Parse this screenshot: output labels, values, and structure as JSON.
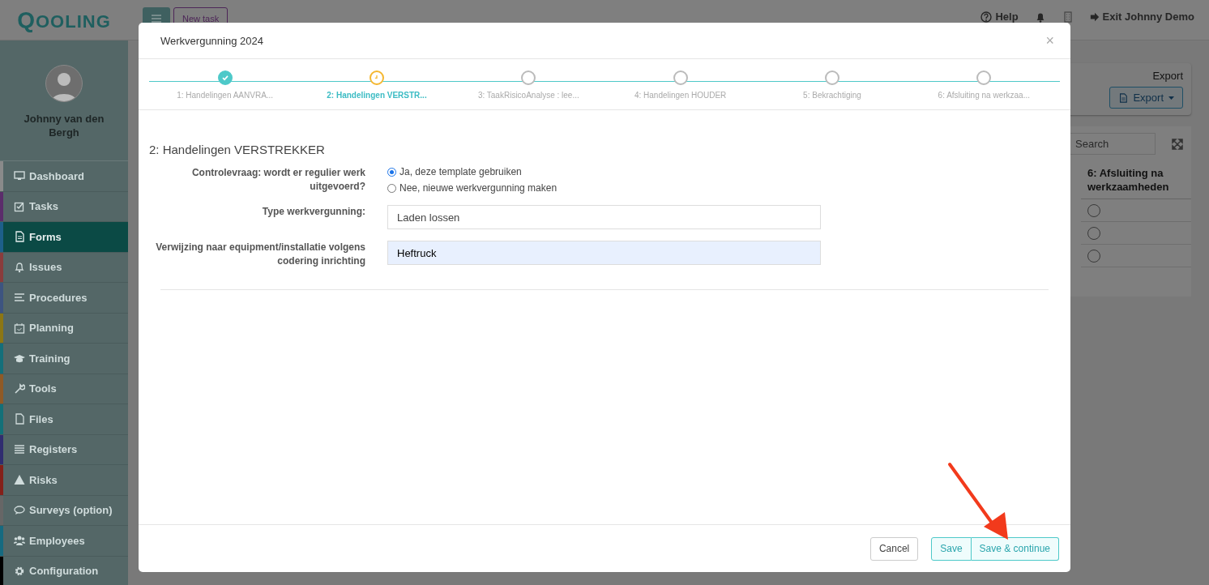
{
  "app": {
    "logo": "QOOLING"
  },
  "topbar": {
    "new_task": "New task",
    "help": "Help",
    "exit": "Exit Johnny Demo"
  },
  "user": {
    "name": "Johnny van den Bergh"
  },
  "sidebar": {
    "items": [
      {
        "label": "Dashboard",
        "selected": false,
        "color": "#8a8a8a"
      },
      {
        "label": "Tasks",
        "selected": false,
        "color": "#5b2d6b"
      },
      {
        "label": "Forms",
        "selected": true,
        "color": "#1d5f8a"
      },
      {
        "label": "Issues",
        "selected": false,
        "color": "#8a3c3c"
      },
      {
        "label": "Procedures",
        "selected": false,
        "color": "#3d5480"
      },
      {
        "label": "Planning",
        "selected": false,
        "color": "#8c7614"
      },
      {
        "label": "Training",
        "selected": false,
        "color": "#146f7a"
      },
      {
        "label": "Tools",
        "selected": false,
        "color": "#8f5a26"
      },
      {
        "label": "Files",
        "selected": false,
        "color": "#137078"
      },
      {
        "label": "Registers",
        "selected": false,
        "color": "#302d70"
      },
      {
        "label": "Risks",
        "selected": false,
        "color": "#842019"
      },
      {
        "label": "Surveys (option)",
        "selected": false,
        "color": "#666666"
      },
      {
        "label": "Employees",
        "selected": false,
        "color": "#166a80"
      },
      {
        "label": "Configuration",
        "selected": false,
        "color": "#000000"
      }
    ]
  },
  "export_panel": {
    "label": "Export",
    "button": "Export"
  },
  "table": {
    "search": {
      "placeholder": "Search"
    },
    "column": "6: Afsluiting na werkzaamheden",
    "rows": [
      {
        "checked": false
      },
      {
        "checked": false
      },
      {
        "checked": false
      }
    ]
  },
  "modal": {
    "title": "Werkvergunning 2024",
    "close": "×",
    "steps": [
      {
        "label": "1: Handelingen AANVRA...",
        "completed": true,
        "selected": false
      },
      {
        "label": "2: Handelingen VERSTR...",
        "completed": false,
        "selected": true
      },
      {
        "label": "3: TaakRisicoAnalyse : lee...",
        "completed": false,
        "selected": false
      },
      {
        "label": "4: Handelingen HOUDER",
        "completed": false,
        "selected": false
      },
      {
        "label": "5: Bekrachtiging",
        "completed": false,
        "selected": false
      },
      {
        "label": "6: Afsluiting na werkzaa...",
        "completed": false,
        "selected": false
      }
    ],
    "section_title": "2: Handelingen VERSTREKKER",
    "fields": [
      {
        "kind": "radio",
        "label": "Controlevraag: wordt er regulier werk uitgevoerd?",
        "options": [
          {
            "label": "Ja, deze template gebruiken",
            "selected": true
          },
          {
            "label": "Nee, nieuwe werkvergunning maken",
            "selected": false
          }
        ]
      },
      {
        "kind": "text",
        "label": "Type werkvergunning:",
        "value": "Laden lossen",
        "autofilled": false
      },
      {
        "kind": "text",
        "label": "Verwijzing naar equipment/installatie volgens codering inrichting",
        "value": "Heftruck",
        "autofilled": true
      }
    ],
    "buttons": [
      {
        "label": "Cancel",
        "kind": "default"
      },
      {
        "label": "Save",
        "kind": "primary"
      },
      {
        "label": "Save & continue",
        "kind": "primary"
      }
    ]
  }
}
